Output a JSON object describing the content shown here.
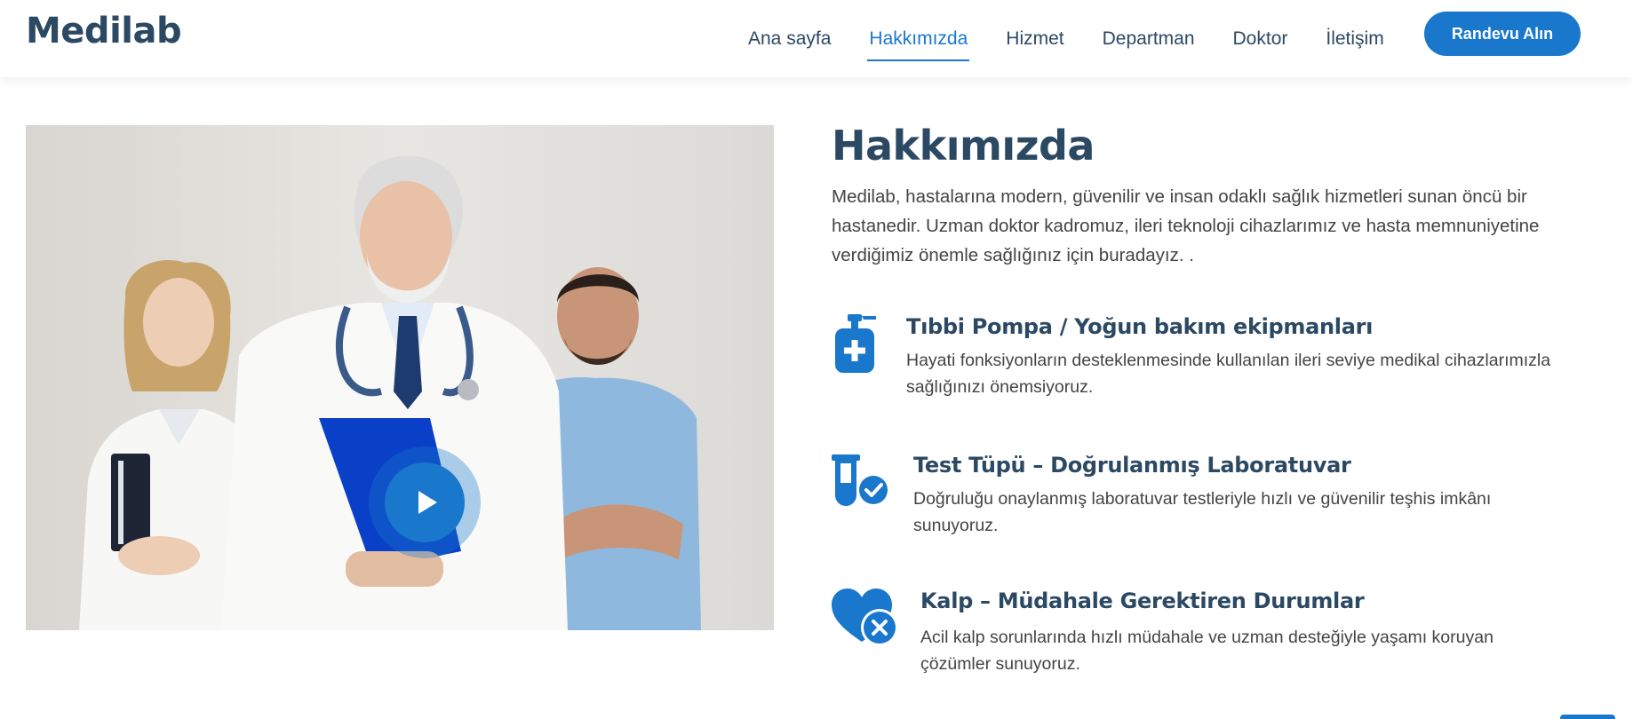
{
  "brand": {
    "logo": "Medilab",
    "accent_color": "#1977cc",
    "heading_color": "#2c4964"
  },
  "nav": {
    "items": [
      {
        "label": "Ana sayfa",
        "active": false
      },
      {
        "label": "Hakkımızda",
        "active": true
      },
      {
        "label": "Hizmet",
        "active": false
      },
      {
        "label": "Departman",
        "active": false
      },
      {
        "label": "Doktor",
        "active": false
      },
      {
        "label": "İletişim",
        "active": false
      }
    ],
    "cta_label": "Randevu Alın"
  },
  "media": {
    "play_icon": "play-icon"
  },
  "about": {
    "title": "Hakkımızda",
    "description": "Medilab, hastalarına modern, güvenilir ve insan odaklı sağlık hizmetleri sunan öncü bir hastanedir. Uzman doktor kadromuz, ileri teknoloji cihazlarımız ve hasta memnuniyetine verdiğimiz önemle sağlığınız için buradayız. .",
    "features": [
      {
        "icon": "pump-bottle-icon",
        "title": "Tıbbi Pompa / Yoğun bakım ekipmanları",
        "text": "Hayati fonksiyonların desteklenmesinde kullanılan ileri seviye medikal cihazlarımızla sağlığınızı önemsiyoruz."
      },
      {
        "icon": "test-tube-check-icon",
        "title": "Test Tüpü – Doğrulanmış Laboratuvar",
        "text": "Doğruluğu onaylanmış laboratuvar testleriyle hızlı ve güvenilir teşhis imkânı sunuyoruz."
      },
      {
        "icon": "heart-x-icon",
        "title": "Kalp – Müdahale Gerektiren Durumlar",
        "text": "Acil kalp sorunlarında hızlı müdahale ve uzman desteğiyle yaşamı koruyan çözümler sunuyoruz."
      }
    ]
  }
}
